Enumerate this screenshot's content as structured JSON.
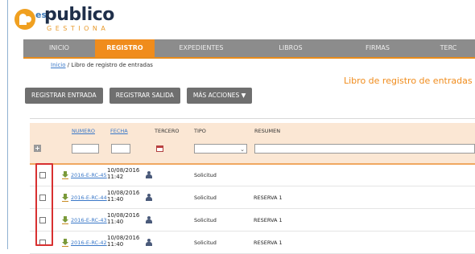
{
  "logo": {
    "es": "es",
    "main": "publico",
    "sub": "GESTIONA"
  },
  "nav": [
    {
      "label": "INICIO",
      "active": false
    },
    {
      "label": "REGISTRO",
      "active": true
    },
    {
      "label": "EXPEDIENTES",
      "active": false
    },
    {
      "label": "LIBROS",
      "active": false
    },
    {
      "label": "FIRMAS",
      "active": false
    },
    {
      "label": "TERC",
      "active": false
    }
  ],
  "breadcrumb": {
    "home": "Inicio",
    "separator": " / ",
    "current": "Libro de registro de entradas"
  },
  "page_title": "Libro de registro de entradas",
  "actions": {
    "register_entry": "REGISTRAR ENTRADA",
    "register_exit": "REGISTRAR SALIDA",
    "more_actions": "MÁS ACCIONES ▼"
  },
  "table": {
    "headers": {
      "numero": "NUMERO",
      "fecha": "FECHA",
      "tercero": "TERCERO",
      "tipo": "TIPO",
      "resumen": "RESUMEN"
    },
    "expand": "+",
    "rows": [
      {
        "numero": "2016-E-RC-45",
        "date": "10/08/2016",
        "time": "11:42",
        "tipo": "Solicitud",
        "resumen": ""
      },
      {
        "numero": "2016-E-RC-44",
        "date": "10/08/2016",
        "time": "11:40",
        "tipo": "Solicitud",
        "resumen": "RESERVA 1"
      },
      {
        "numero": "2016-E-RC-43",
        "date": "10/08/2016",
        "time": "11:40",
        "tipo": "Solicitud",
        "resumen": "RESERVA 1"
      },
      {
        "numero": "2016-E-RC-42",
        "date": "10/08/2016",
        "time": "11:40",
        "tipo": "Solicitud",
        "resumen": "RESERVA 1"
      }
    ]
  },
  "colors": {
    "accent": "#f08c1c",
    "nav_bg": "#8c8c8c",
    "link": "#3a78c8",
    "highlight": "#d83030"
  }
}
